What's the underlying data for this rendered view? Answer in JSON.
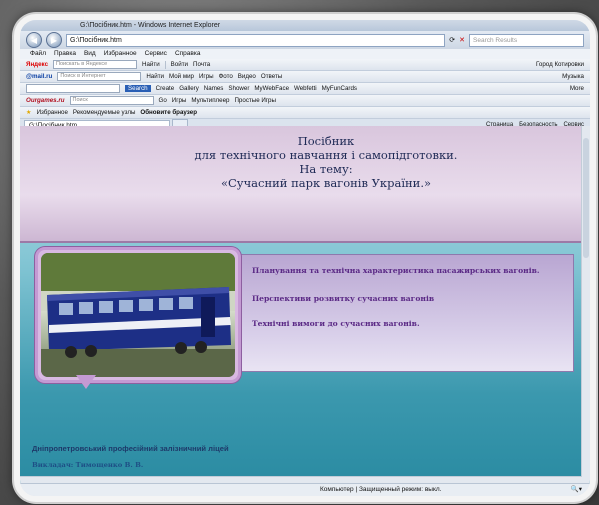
{
  "window": {
    "title": "G:\\Посібник.htm - Windows Internet Explorer"
  },
  "address": {
    "url": "G:\\Посібник.htm",
    "search_placeholder": "Search Results"
  },
  "menu": [
    "Файл",
    "Правка",
    "Вид",
    "Избранное",
    "Сервис",
    "Справка"
  ],
  "toolbars": {
    "yandex": {
      "brand": "Яндекс",
      "search_placeholder": "Поискать в Яндексе",
      "find_label": "Найти",
      "items": [
        "Войти",
        "Почта",
        "Город",
        "Котировки"
      ]
    },
    "mail": {
      "brand": "@mail.ru",
      "search_placeholder": "Поиск в Интернет",
      "find_label": "Найти",
      "items": [
        "Мой мир",
        "Игры",
        "Фото",
        "Видео",
        "Ответы",
        "Музыка"
      ]
    },
    "search": {
      "button_label": "Search",
      "items": [
        "Create",
        "Gallery",
        "Names",
        "Shower",
        "MyWebFace",
        "Webfetti",
        "MyFunCards",
        "More"
      ]
    },
    "ourgames": {
      "brand": "Ourgames.ru",
      "search_placeholder": "Поиск",
      "go_label": "Go",
      "items": [
        "Игры",
        "Мультиплеер",
        "Простые Игры"
      ]
    },
    "favorites": {
      "label": "Избранное",
      "items": [
        "Рекомендуемые узлы",
        "Обновите браузер"
      ]
    }
  },
  "tabs": [
    {
      "label": "G:\\Посібник.htm"
    }
  ],
  "command_bar": [
    "Страница",
    "Безопасность",
    "Сервис"
  ],
  "page": {
    "title_lines": [
      "Посібник",
      "для технічного навчання і  самопідготовки.",
      "На тему:",
      "«Сучасний парк вагонів України.»"
    ],
    "topics": [
      "Планування та технічна характеристика  пасажирських вагонів.",
      "Перспективи розвитку сучасних  вагонів",
      "Технічні вимоги до сучасних вагонів."
    ],
    "school": "Дніпропетровський професійний залізничний ліцей",
    "teacher": "Викладач: Тимощенко В. В."
  },
  "status": {
    "zone": "Компьютер | Защищенный режим: выкл."
  }
}
